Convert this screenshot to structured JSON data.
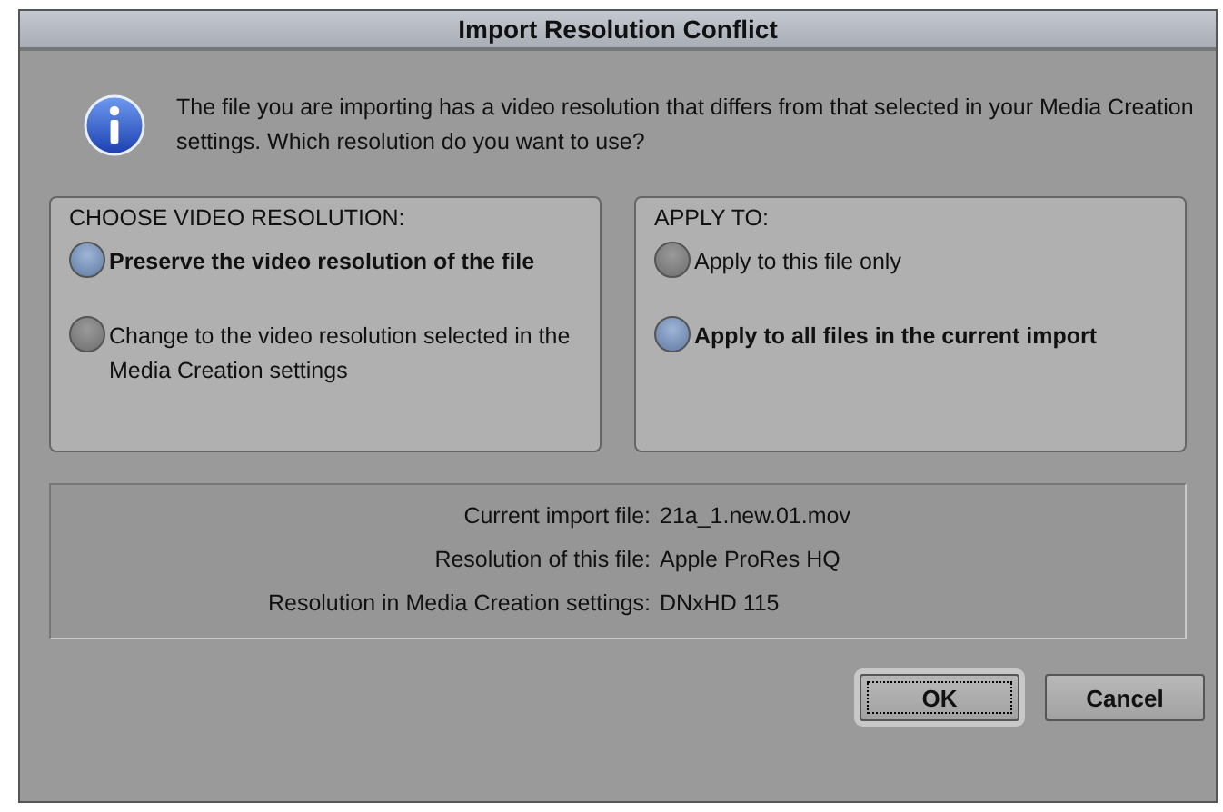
{
  "window": {
    "title": "Import Resolution Conflict"
  },
  "message": "The file you are importing has a video resolution that differs from that selected in your Media Creation settings.  Which resolution do you want to use?",
  "groups": [
    {
      "heading": "CHOOSE VIDEO RESOLUTION:",
      "options": [
        {
          "label": "Preserve the video resolution of the file",
          "selected": true
        },
        {
          "label": "Change to the video resolution selected in the Media Creation settings",
          "selected": false
        }
      ]
    },
    {
      "heading": "APPLY TO:",
      "options": [
        {
          "label": "Apply to this file only",
          "selected": false
        },
        {
          "label": "Apply to all files in the current import",
          "selected": true
        }
      ]
    }
  ],
  "details": [
    {
      "label": "Current import file:",
      "value": "21a_1.new.01.mov"
    },
    {
      "label": "Resolution of this file:",
      "value": "Apple ProRes HQ"
    },
    {
      "label": "Resolution in Media Creation settings:",
      "value": "DNxHD 115"
    }
  ],
  "buttons": [
    {
      "label": "OK",
      "default": true
    },
    {
      "label": "Cancel",
      "default": false
    }
  ]
}
